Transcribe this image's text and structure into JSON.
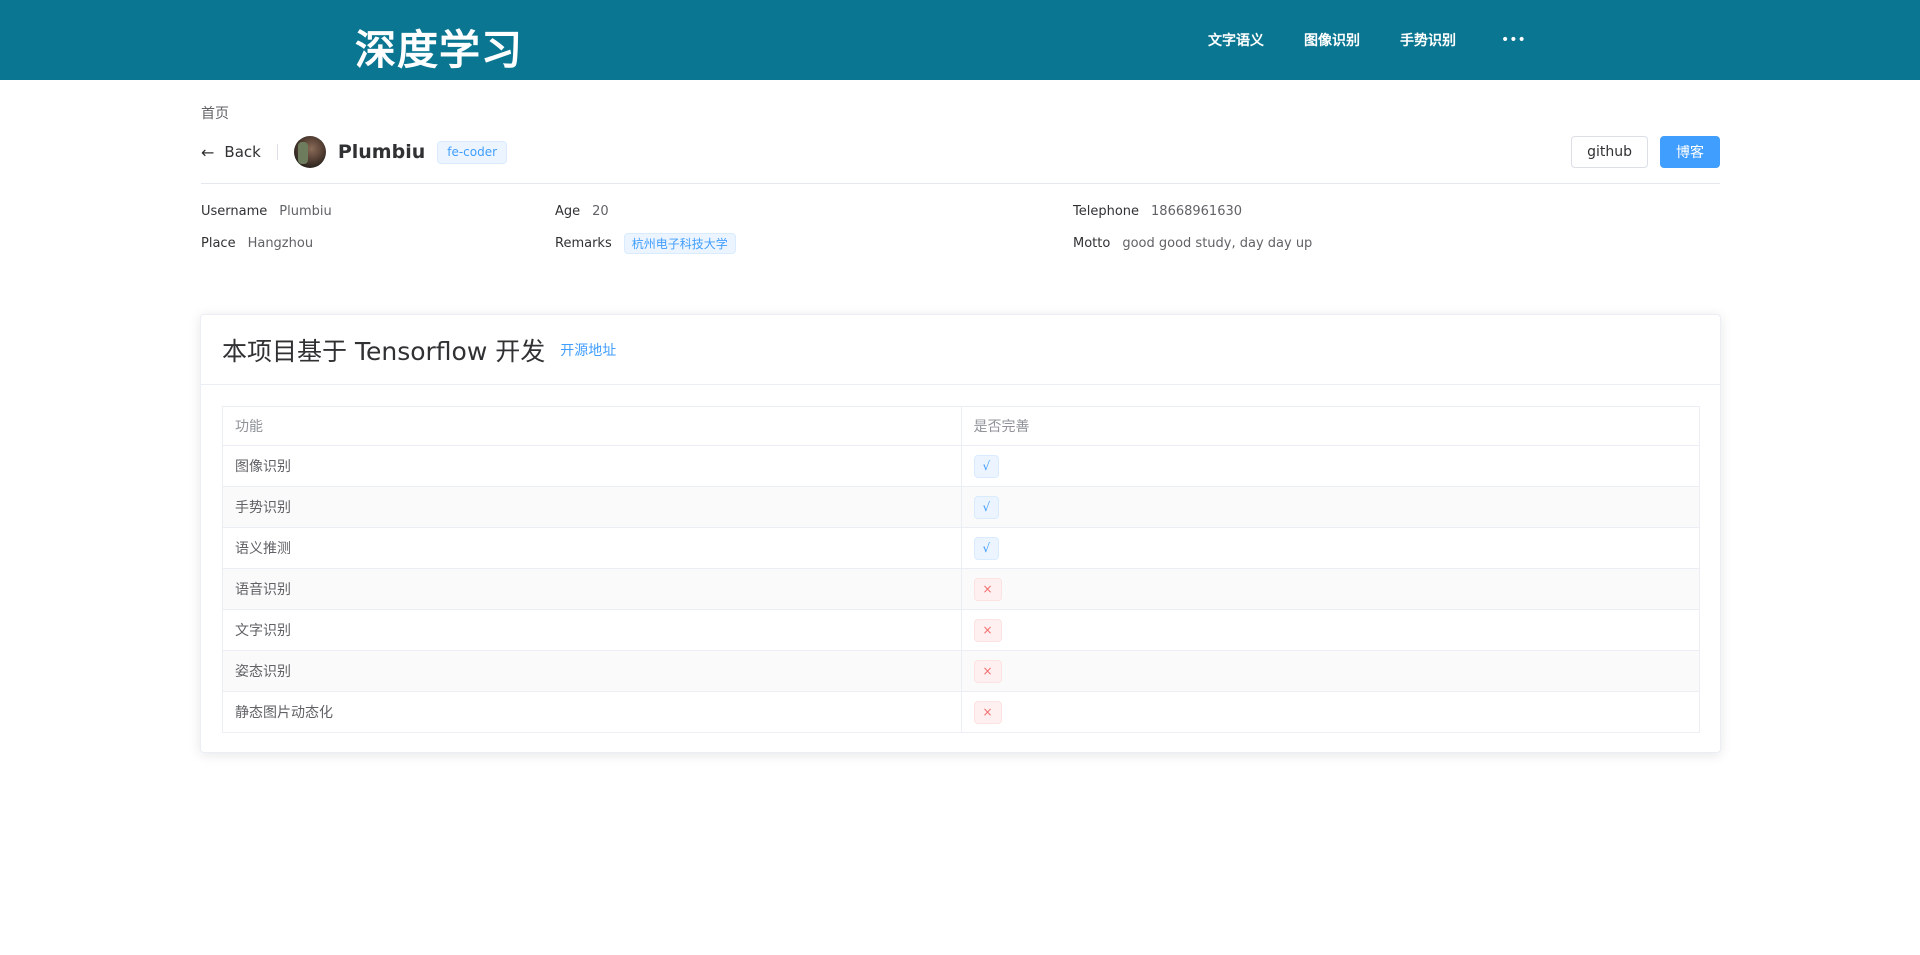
{
  "header": {
    "brand": "深度学习",
    "nav": [
      "文字语义",
      "图像识别",
      "手势识别"
    ],
    "more": "•••"
  },
  "breadcrumb": "首页",
  "page_header": {
    "back_label": "Back",
    "title": "Plumbiu",
    "tag": "fe-coder",
    "github_label": "github",
    "blog_label": "博客"
  },
  "descriptions": {
    "username": {
      "label": "Username",
      "value": "Plumbiu"
    },
    "age": {
      "label": "Age",
      "value": "20"
    },
    "telephone": {
      "label": "Telephone",
      "value": "18668961630"
    },
    "place": {
      "label": "Place",
      "value": "Hangzhou"
    },
    "remarks": {
      "label": "Remarks",
      "value": "杭州电子科技大学"
    },
    "motto": {
      "label": "Motto",
      "value": "good good study, day day up"
    }
  },
  "card": {
    "title": "本项目基于 Tensorflow 开发",
    "link": "开源地址"
  },
  "table": {
    "columns": [
      "功能",
      "是否完善"
    ],
    "rows": [
      {
        "feature": "图像识别",
        "status": "√",
        "done": true
      },
      {
        "feature": "手势识别",
        "status": "√",
        "done": true
      },
      {
        "feature": "语义推测",
        "status": "√",
        "done": true
      },
      {
        "feature": "语音识别",
        "status": "×",
        "done": false
      },
      {
        "feature": "文字识别",
        "status": "×",
        "done": false
      },
      {
        "feature": "姿态识别",
        "status": "×",
        "done": false
      },
      {
        "feature": "静态图片动态化",
        "status": "×",
        "done": false
      }
    ]
  },
  "colors": {
    "topbar": "#0a7691",
    "primary": "#409eff",
    "danger": "#f56c6c"
  }
}
